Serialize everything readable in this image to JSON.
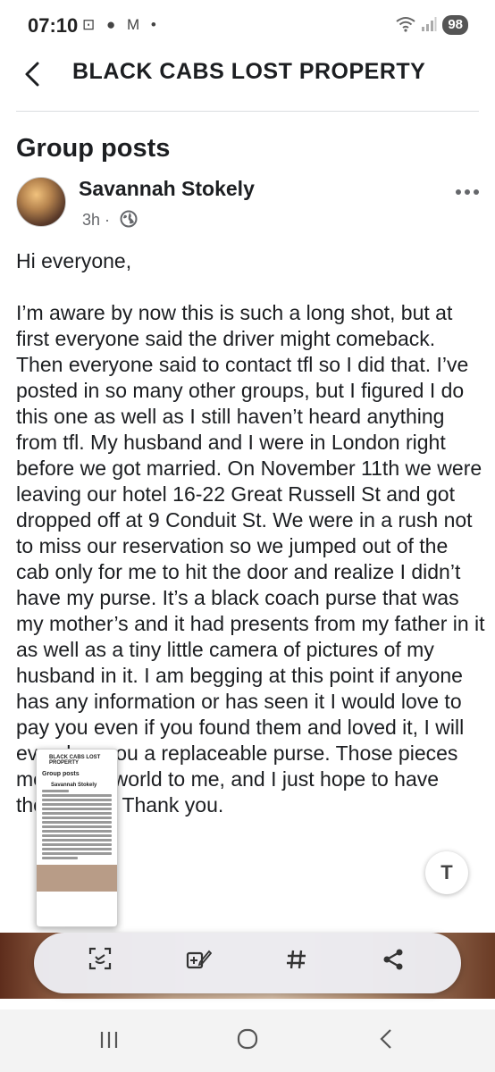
{
  "status_bar": {
    "time": "07:10",
    "notification_icons": "⊡ ● M •",
    "battery": "98"
  },
  "header": {
    "title": "BLACK CABS LOST PROPERTY"
  },
  "section": {
    "title": "Group posts"
  },
  "post": {
    "author": "Savannah Stokely",
    "time": "3h ·",
    "body": "Hi everyone,\n\nI’m aware by now this is such a long shot, but at first everyone said the driver might comeback. Then everyone said to contact tfl so I did that. I’ve posted in so many other groups, but I figured I do this one as well as I still haven’t heard anything from tfl. My husband and I were in London right before we got married. On November 11th we were leaving our hotel 16-22 Great Russell St and got dropped off at 9 Conduit St. We were in a rush not to miss our reservation so we jumped out of the cab only for me to hit the door and realize I didn’t have my purse. It’s a black coach purse that was my mother’s and it had presents from my father in it as well as a tiny little camera of pictures of my husband in it. I am begging at this point if anyone has any information or has seen it I would love to pay you even if you found them and loved it, I will even buy you a replaceable purse. Those pieces meant the world to me, and I just hope to have them back. Thank you."
  },
  "thumbnail": {
    "title": "BLACK CABS LOST PROPERTY",
    "section": "Group posts",
    "author": "Savannah Stokely"
  },
  "toolbar": {
    "translate_icon": "T",
    "tools": [
      "scan-icon",
      "add-tag-icon",
      "hashtag-icon",
      "share-icon"
    ]
  },
  "nav": {
    "recents": "|||",
    "home": "○",
    "back": "<"
  }
}
